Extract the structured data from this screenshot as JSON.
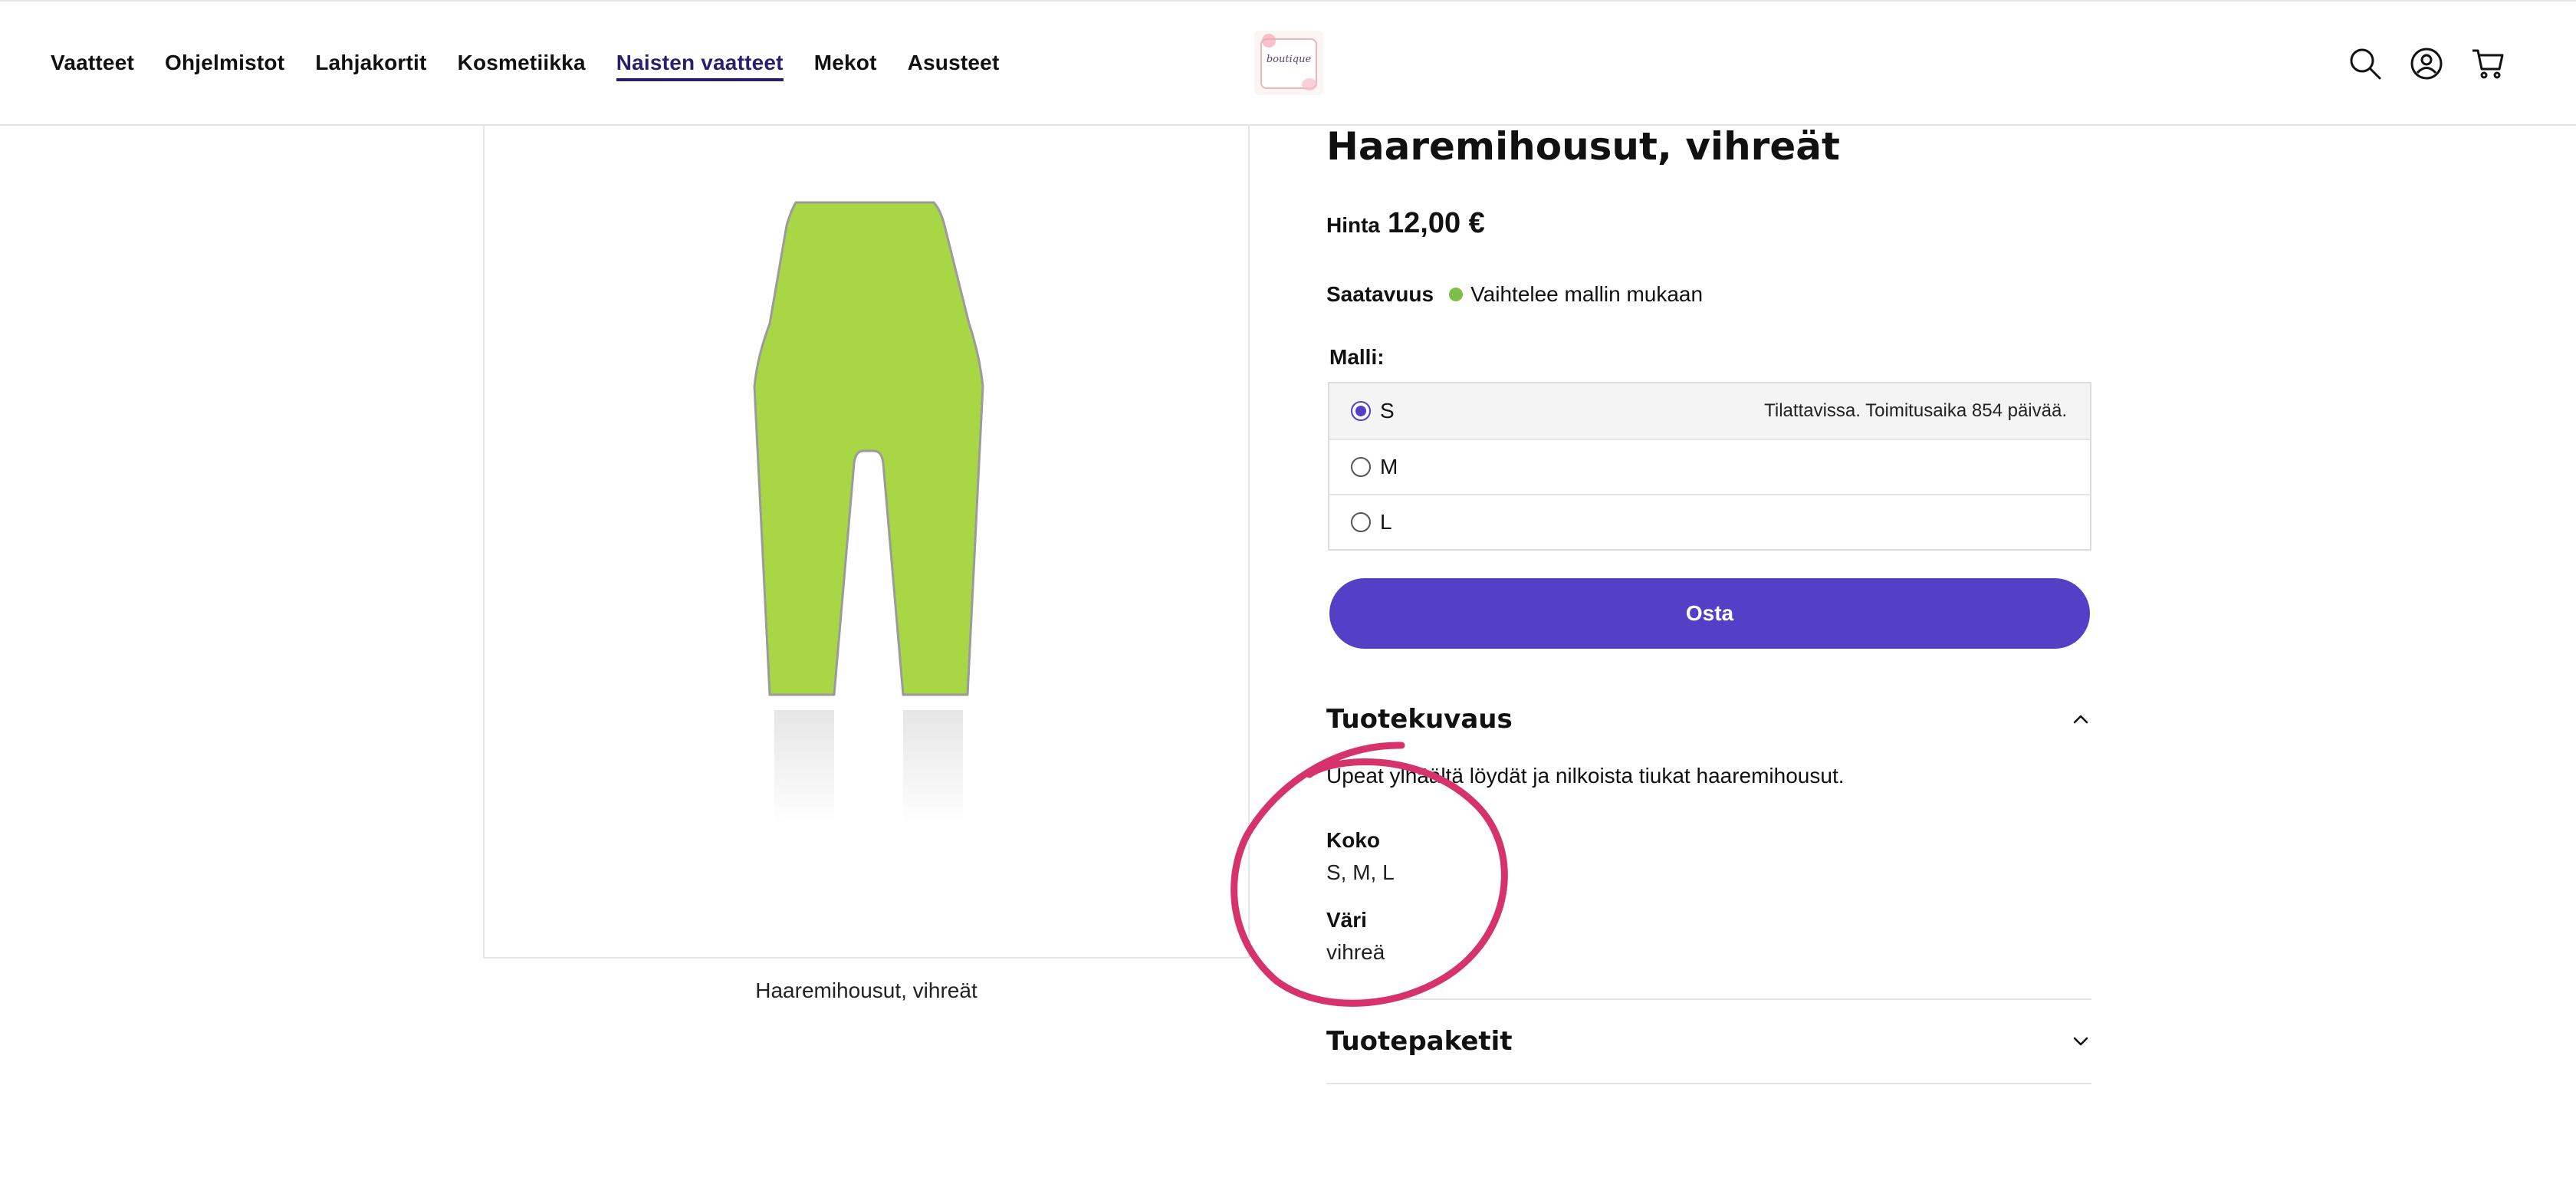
{
  "header": {
    "nav": [
      "Vaatteet",
      "Ohjelmistot",
      "Lahjakortit",
      "Kosmetiikka",
      "Naisten vaatteet",
      "Mekot",
      "Asusteet"
    ],
    "active_nav": "Naisten vaatteet",
    "logo_text": "boutique",
    "icons": [
      "search-icon",
      "user-icon",
      "cart-icon"
    ]
  },
  "product": {
    "title": "Haaremihousut, vihreät",
    "price_label": "Hinta",
    "price": "12,00 €",
    "availability_label": "Saatavuus",
    "availability": "Vaihtelee mallin mukaan",
    "availability_color": "#7cc04b",
    "image_caption": "Haaremihousut, vihreät",
    "pants_color": "#a8d645"
  },
  "variants": {
    "label": "Malli:",
    "options": [
      {
        "name": "S",
        "note": "Tilattavissa. Toimitusaika 854 päivää.",
        "selected": true
      },
      {
        "name": "M",
        "note": "",
        "selected": false
      },
      {
        "name": "L",
        "note": "",
        "selected": false
      }
    ]
  },
  "buy_button": "Osta",
  "accent_color": "#5340c6",
  "description_section": {
    "title": "Tuotekuvaus",
    "text": "Upeat ylhäältä löydät ja nilkoista tiukat haaremihousut.",
    "attributes": [
      {
        "label": "Koko",
        "value": "S, M, L"
      },
      {
        "label": "Väri",
        "value": "vihreä"
      }
    ]
  },
  "packages_section": {
    "title": "Tuotepaketit"
  },
  "annotation_color": "#d6336c"
}
